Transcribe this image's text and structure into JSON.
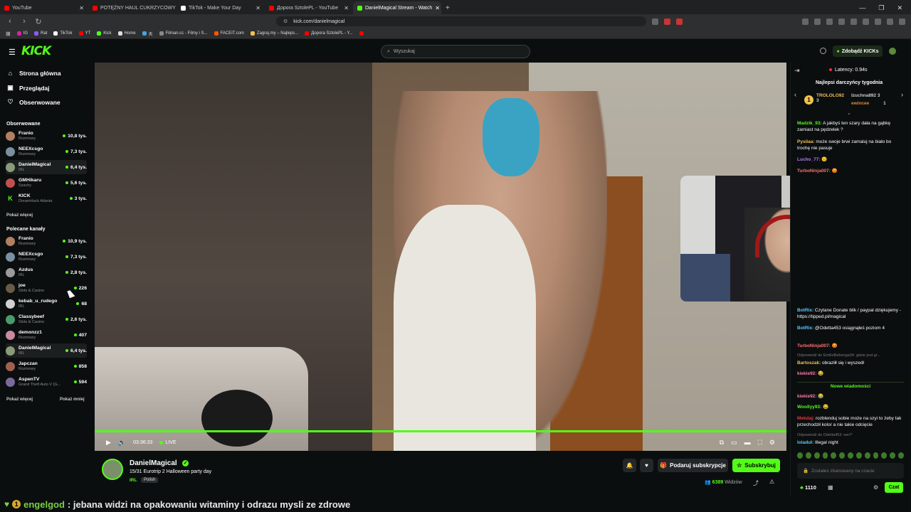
{
  "browser": {
    "tabs": [
      {
        "label": "YouTube",
        "color": "#ff0000"
      },
      {
        "label": "POTĘŻNY HAUL CUKRZYCOWY - ile t",
        "color": "#ff0000"
      },
      {
        "label": "TikTok - Make Your Day",
        "color": "#ffffff"
      },
      {
        "label": "Дорога SztolePL - YouTube",
        "color": "#ff0000"
      },
      {
        "label": "DanielMagical Stream - Watch",
        "color": "#53fc18",
        "active": true
      }
    ],
    "url": "kick.com/danielmagical",
    "bookmarks": [
      {
        "label": "IG",
        "color": "#d6249f"
      },
      {
        "label": "Rat",
        "color": "#8a5cf6"
      },
      {
        "label": "TikTok",
        "color": "#ffffff"
      },
      {
        "label": "YT",
        "color": "#ff0000"
      },
      {
        "label": "Kick",
        "color": "#53fc18"
      },
      {
        "label": "Home",
        "color": "#dddddd"
      },
      {
        "label": "天",
        "color": "#4aa3df"
      },
      {
        "label": "Filman.cc - Filmy i S...",
        "color": "#888888"
      },
      {
        "label": "FACEIT.com",
        "color": "#ff5500"
      },
      {
        "label": "Zagraj.my – Najleps...",
        "color": "#f2c14e"
      },
      {
        "label": "Дорога SztolePL - Y...",
        "color": "#ff0000"
      },
      {
        "label": "",
        "color": "#ff0000"
      }
    ]
  },
  "header": {
    "logo": "KICK",
    "search_placeholder": "Wyszukaj",
    "kicks_button": "Zdobądź KICKs"
  },
  "sidebar": {
    "nav": [
      {
        "label": "Strona główna",
        "icon": "home-icon"
      },
      {
        "label": "Przeglądaj",
        "icon": "browse-icon"
      },
      {
        "label": "Obserwowane",
        "icon": "heart-icon"
      }
    ],
    "followed_title": "Obserwowane",
    "followed": [
      {
        "name": "Franio",
        "category": "Rozmowy",
        "viewers": "10,8 tys."
      },
      {
        "name": "NEEXcsgo",
        "category": "Rozmowy",
        "viewers": "7,3 tys."
      },
      {
        "name": "DanielMagical",
        "category": "IRL",
        "viewers": "6,4 tys."
      },
      {
        "name": "GMHikaru",
        "category": "Szachy",
        "viewers": "5,6 tys."
      },
      {
        "name": "KICK",
        "category": "DreamHack Atlanta",
        "viewers": "3 tys."
      }
    ],
    "show_more": "Pokaż więcej",
    "recommended_title": "Polecane kanały",
    "recommended": [
      {
        "name": "Franio",
        "category": "Rozmowy",
        "viewers": "10,9 tys."
      },
      {
        "name": "NEEXcsgo",
        "category": "Rozmowy",
        "viewers": "7,3 tys."
      },
      {
        "name": "Azdus",
        "category": "IRL",
        "viewers": "2,8 tys."
      },
      {
        "name": "joe",
        "category": "Slots & Casino",
        "viewers": "226"
      },
      {
        "name": "kebab_u_rudego",
        "category": "IRL",
        "viewers": "68"
      },
      {
        "name": "Classybeef",
        "category": "Slots & Casino",
        "viewers": "2,6 tys."
      },
      {
        "name": "demonzz1",
        "category": "Rozmowy",
        "viewers": "407"
      },
      {
        "name": "DanielMagical",
        "category": "IRL",
        "viewers": "6,4 tys."
      },
      {
        "name": "Japczan",
        "category": "Rozmowy",
        "viewers": "858"
      },
      {
        "name": "AspenTV",
        "category": "Grand Theft Auto V (G...",
        "viewers": "594"
      }
    ],
    "show_more2": "Pokaż więcej",
    "show_less": "Pokaż mniej"
  },
  "player": {
    "time": "03:36:33",
    "live": "LIVE"
  },
  "channel": {
    "name": "DanielMagical",
    "title": "15/31 Eurotrip 2 Halloween party day",
    "category": "IRL",
    "language": "Polish",
    "gift_button": "Podaruj subskrypcje",
    "subscribe_button": "Subskrybuj",
    "viewers": "6389",
    "viewers_label": "Widzów"
  },
  "chat": {
    "latency": "Latency: 0.94s",
    "top_gifters_title": "Najlepsi darczyńcy tygodnia",
    "gifters": [
      {
        "name": "TROLOLO92",
        "count": "3",
        "color": "#f2c14e"
      },
      {
        "name": "Izuchna892",
        "count": "3",
        "color": "#cccccc"
      },
      {
        "name": "ewincee",
        "count": "1",
        "color": "#e08a3a"
      }
    ],
    "messages_top": [
      {
        "user": "Madzik_93:",
        "color": "#53fc18",
        "text": " A jakbyś ten szary dała na gąbkę zamiast na pędzelek ?"
      },
      {
        "user": "Pysiiaa:",
        "color": "#f2c14e",
        "text": " może swoje brwi zamaluj na biało bo trochę nie pasuje"
      },
      {
        "user": "Lucho_77:",
        "color": "#b07cf0",
        "text": " 😐"
      },
      {
        "user": "TurboNinja007:",
        "color": "#ff7070",
        "text": " 😡"
      }
    ],
    "messages_bottom": [
      {
        "user": "BotRix:",
        "color": "#5ec8ff",
        "text": " Czytane Donate blik / paypal dziękujemy - https://tipped.pl/magical"
      },
      {
        "user": "BotRix:",
        "color": "#5ec8ff",
        "text": " @Odetta453 osiągnąłeś poziom 4"
      },
      {
        "user": "TurboNinja007:",
        "color": "#ff7070",
        "text": " 😡"
      },
      {
        "user": "Bartoszak:",
        "color": "#f2c14e",
        "text": " obraziłł się i wyszedł"
      },
      {
        "user": "kiekie92:",
        "color": "#ff7aa8",
        "text": " 😂"
      }
    ],
    "reply1": "Odpowiedź do EmilioBebenga34: gdzie jest gr...",
    "new_messages": "Nowe wiadomości",
    "messages_new": [
      {
        "user": "kiekie92:",
        "color": "#ff7aa8",
        "text": " 😂"
      },
      {
        "user": "Woollyy93:",
        "color": "#53fc18",
        "text": " 😂"
      },
      {
        "user": "Mekdaj:",
        "color": "#e03a3a",
        "text": " rozblenduj sobie może na szyi to żeby tak przechodził kolor a nie takie odcięcie"
      }
    ],
    "reply2": "Odpowiedź do Odetta453: wer?",
    "message_last": {
      "user": "loladuł:",
      "color": "#5ec8ff",
      "text": " Illegal night"
    },
    "input_placeholder": "Zostałeś zbanowany na czacie",
    "kicks": "1110",
    "send": "Czat"
  },
  "overlay": {
    "badge": "1",
    "user": "engelgod",
    "text": ": jebana widzi na opakowaniu witaminy i odrazu mysli ze zdrowe"
  }
}
